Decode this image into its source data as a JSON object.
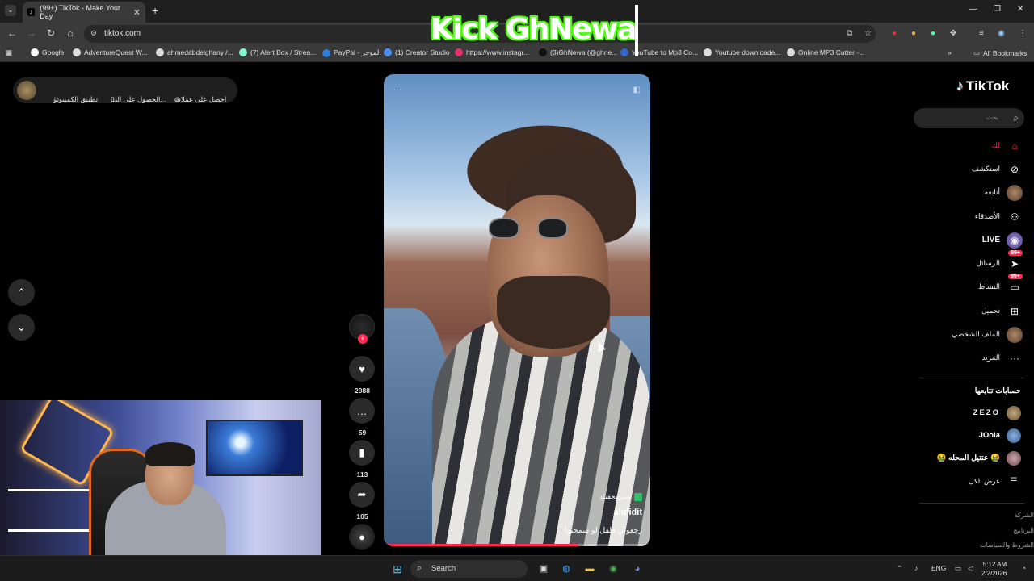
{
  "browser": {
    "tab_title": "(99+) TikTok - Make Your Day",
    "url": "tiktok.com",
    "bookmarks": [
      "Google",
      "AdventureQuest W...",
      "ahmedabdelghany /...",
      "(7) Alert Box / Strea...",
      "PayPal - الموجز",
      "(1) Creator Studio",
      "https://www.instagr...",
      "(3)GhNewa (@ghne...",
      "YouTube to Mp3 Co...",
      "Youtube downloade...",
      "Online MP3 Cutter -..."
    ],
    "all_bookmarks": "All Bookmarks"
  },
  "overlay": {
    "kick_text": "Kick GhNewa"
  },
  "topbar": {
    "get_coins": "احصل على عملات",
    "get_app": "الحصول على الت...",
    "desktop_app": "تطبيق الكمبيوتر"
  },
  "video": {
    "badge_text": "سبرينجفيلد",
    "author": "_alididit",
    "caption": "رجعوني طفل لو سمحتوا",
    "progress": 0.73
  },
  "actions": {
    "likes": "2988",
    "comments": "59",
    "saves": "113",
    "shares": "105"
  },
  "sidebar": {
    "logo": "TikTok",
    "search_placeholder": "بحث",
    "nav": [
      {
        "label": "لك",
        "icon": "home-icon",
        "active": true
      },
      {
        "label": "استكشف",
        "icon": "compass-icon"
      },
      {
        "label": "أتابعه",
        "icon": "following-avatar"
      },
      {
        "label": "الأصدقاء",
        "icon": "friends-icon"
      },
      {
        "label": "LIVE",
        "icon": "live-icon"
      },
      {
        "label": "الرسائل",
        "icon": "messages-icon",
        "badge": "99+"
      },
      {
        "label": "النشاط",
        "icon": "activity-icon",
        "badge": "99+"
      },
      {
        "label": "تحميل",
        "icon": "upload-icon"
      },
      {
        "label": "الملف الشخصي",
        "icon": "profile-avatar"
      },
      {
        "label": "المزيد",
        "icon": "more-icon"
      }
    ],
    "following_title": "حسابات تتابعها",
    "following": [
      "ZEZO",
      "JOola",
      "🤮 عتتيل المحله 🤮"
    ],
    "see_all": "عرض الكل",
    "footer": [
      "الشركة",
      "البرنامج",
      "الشروط والسياسات"
    ]
  },
  "taskbar": {
    "search_label": "Search",
    "lang": "ENG",
    "time": "5:12 AM",
    "date": "2/2/2026"
  }
}
